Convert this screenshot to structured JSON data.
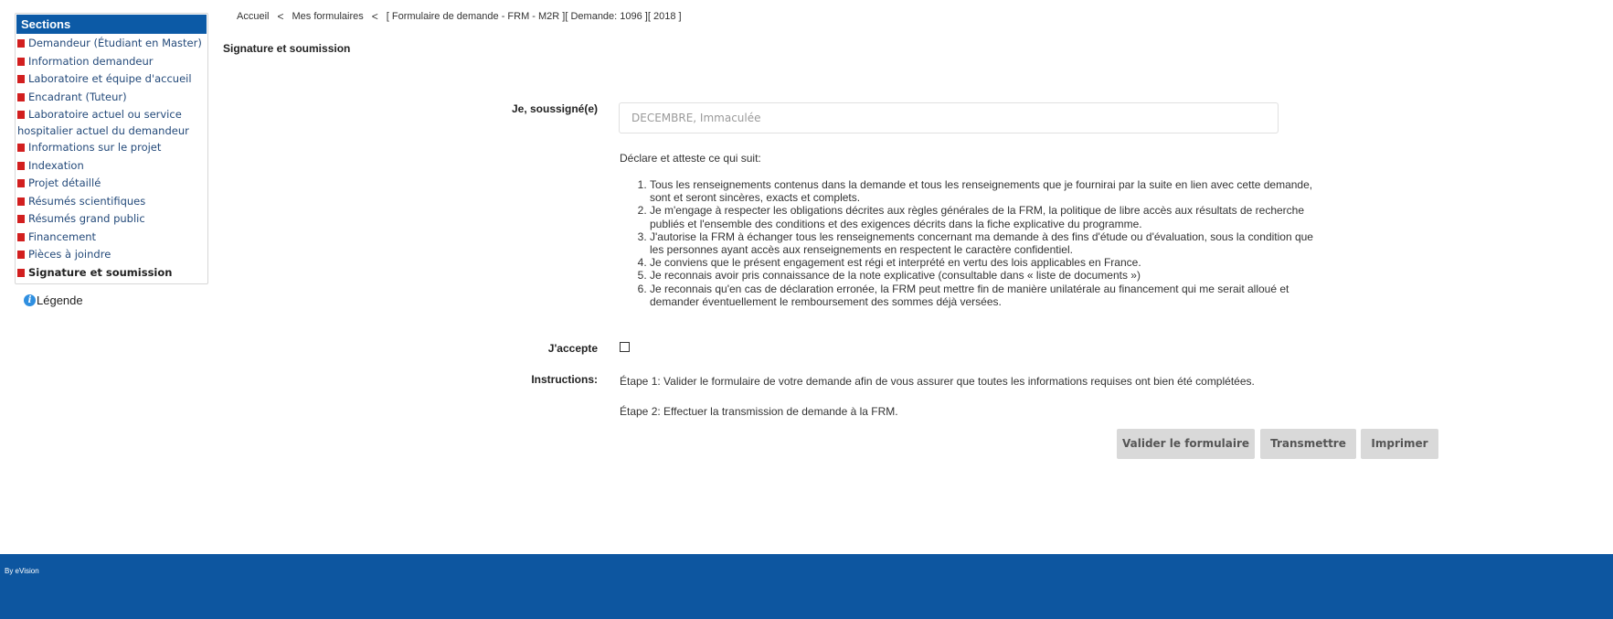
{
  "sidebar": {
    "header": "Sections",
    "items": [
      {
        "label": "Demandeur (Étudiant en Master)"
      },
      {
        "label": "Information demandeur"
      },
      {
        "label": "Laboratoire et équipe d'accueil"
      },
      {
        "label": "Encadrant (Tuteur)"
      },
      {
        "label": "Laboratoire actuel ou service hospitalier actuel du demandeur"
      },
      {
        "label": "Informations sur le projet"
      },
      {
        "label": "Indexation"
      },
      {
        "label": "Projet détaillé"
      },
      {
        "label": "Résumés scientifiques"
      },
      {
        "label": "Résumés grand public"
      },
      {
        "label": "Financement"
      },
      {
        "label": "Pièces à joindre"
      },
      {
        "label": "Signature et soumission"
      }
    ],
    "legend": "Légende"
  },
  "breadcrumb": {
    "home": "Accueil",
    "forms": "Mes formulaires",
    "current": "[ Formulaire de demande - FRM - M2R ][ Demande: 1096 ][ 2018 ]",
    "separator": "<"
  },
  "page_title": "Signature et soumission",
  "form": {
    "signer_label": "Je, soussigné(e)",
    "signer_value": "DECEMBRE, Immaculée",
    "declare_intro": "Déclare et atteste ce qui suit:",
    "declarations": [
      "Tous les renseignements contenus dans la demande et tous les renseignements que je fournirai par la suite en lien avec cette demande, sont et seront sincères, exacts et complets.",
      "Je m'engage à respecter les obligations décrites aux règles générales de la FRM, la politique de libre accès aux résultats de recherche publiés et l'ensemble des conditions et des exigences décrits dans la fiche explicative du programme.",
      "J'autorise la FRM à échanger tous les renseignements concernant ma demande à des fins d'étude ou d'évaluation, sous la condition que les personnes ayant accès aux renseignements en respectent le caractère confidentiel.",
      "Je conviens que le présent engagement est régi et interprété en vertu des lois applicables en France.",
      "Je reconnais avoir pris connaissance de la note explicative (consultable dans « liste de documents »)",
      "Je reconnais qu'en cas de déclaration erronée, la FRM peut mettre fin de manière unilatérale au financement qui me serait alloué et demander éventuellement le remboursement des sommes déjà versées."
    ],
    "accept_label": "J'accepte",
    "accept_checked": false,
    "instructions_label": "Instructions:",
    "step1": "Étape 1: Valider le formulaire de votre demande afin de vous assurer que toutes les informations requises ont bien été complétées.",
    "step2": "Étape 2: Effectuer la transmission de demande à la FRM."
  },
  "buttons": {
    "validate": "Valider le formulaire",
    "transmit": "Transmettre",
    "print": "Imprimer"
  },
  "footer": {
    "text": "By eVision"
  },
  "colors": {
    "sidebar_header": "#0c5aa6",
    "footer": "#0d56a0",
    "bullet": "#d21f1f",
    "button_bg": "#d9d9d9"
  }
}
